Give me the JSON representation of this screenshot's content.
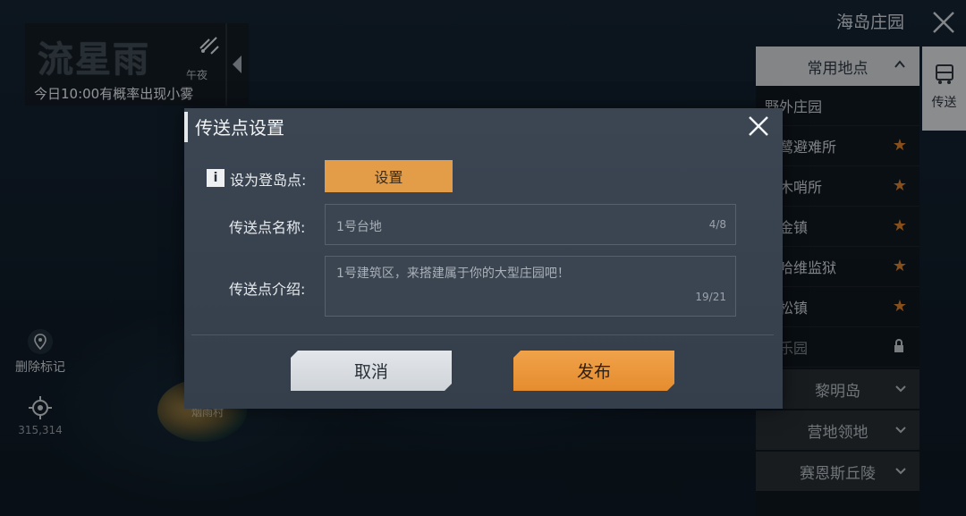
{
  "header": {
    "map_title": "海岛庄园"
  },
  "weather": {
    "title": "流星雨",
    "time_of_day": "午夜",
    "forecast": "今日10:00有概率出现小雾"
  },
  "left_tools": {
    "delete_marker_label": "删除标记",
    "coordinates": "315,314"
  },
  "map": {
    "island_label": "烟雨村"
  },
  "sidebar": {
    "teleport_tab_label": "传送",
    "section_header": "常用地点",
    "items": [
      {
        "label": "野外庄园",
        "icon": "none"
      },
      {
        "label": "雪鹭避难所",
        "icon": "star-icon"
      },
      {
        "label": "伐木哨所",
        "icon": "star-icon"
      },
      {
        "label": "淘金镇",
        "icon": "star-icon"
      },
      {
        "label": "索哈维监狱",
        "icon": "star-icon"
      },
      {
        "label": "落松镇",
        "icon": "star-icon"
      },
      {
        "label": "亚乐园",
        "icon": "lock-icon"
      }
    ],
    "groups": [
      "黎明岛",
      "营地领地",
      "赛恩斯丘陵"
    ]
  },
  "dialog": {
    "title": "传送点设置",
    "set_landing_label": "设为登岛点:",
    "set_button": "设置",
    "name_label": "传送点名称:",
    "name_value": "1号台地",
    "name_count": "4/8",
    "intro_label": "传送点介绍:",
    "intro_value": "1号建筑区，来搭建属于你的大型庄园吧！",
    "intro_count": "19/21",
    "cancel_button": "取消",
    "publish_button": "发布"
  },
  "colors": {
    "accent_orange": "#e39c47",
    "star_orange": "#cf7a2a",
    "dialog_bg": "#3c4653"
  }
}
